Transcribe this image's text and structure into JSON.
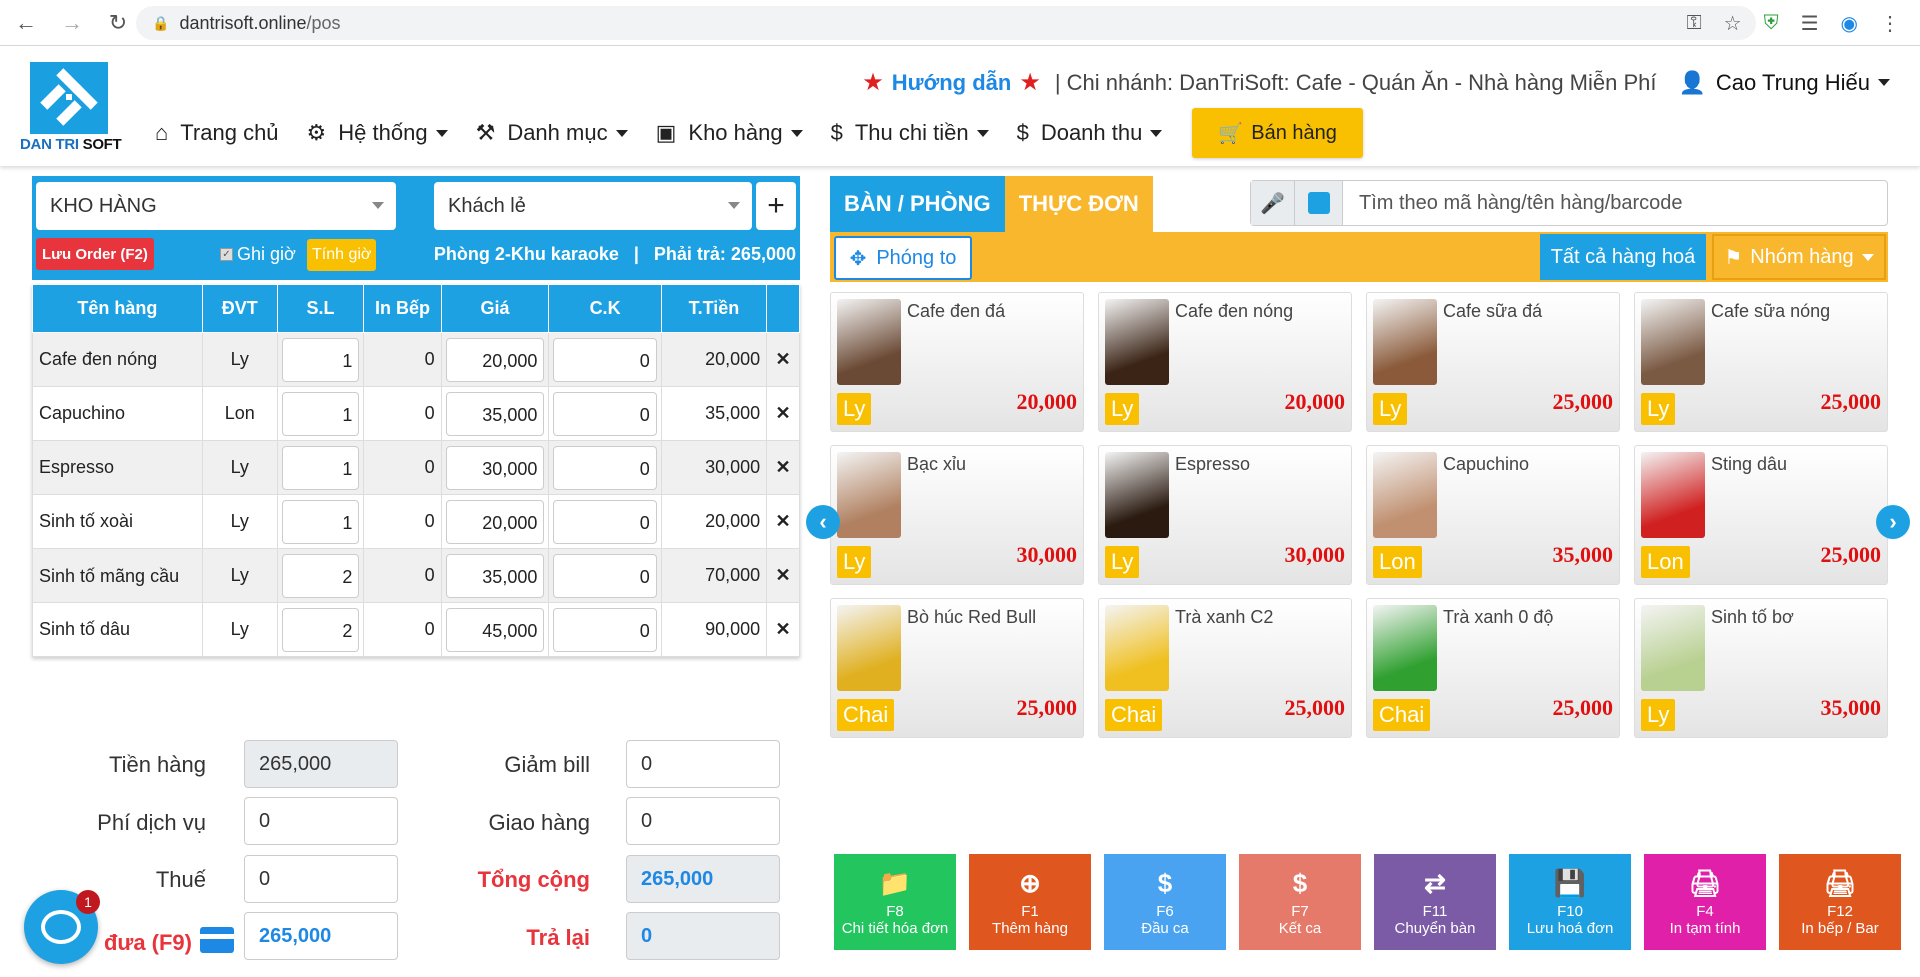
{
  "browser": {
    "url_host": "dantrisoft.online",
    "url_path": "/pos"
  },
  "header": {
    "logo_text_a": "DAN TRI",
    "logo_text_b": "SOFT",
    "guide": "Hướng dẫn",
    "branch": "| Chi nhánh: DanTriSoft: Cafe - Quán Ăn - Nhà hàng Miễn Phí",
    "user": "Cao Trung Hiếu",
    "nav": [
      "Trang chủ",
      "Hệ thống",
      "Danh mục",
      "Kho hàng",
      "Thu chi tiền",
      "Doanh thu"
    ],
    "sell": "Bán hàng"
  },
  "order": {
    "warehouse": "KHO HÀNG",
    "customer": "Khách lẻ",
    "save_order": "Lưu Order (F2)",
    "ghi_gio": "Ghi giờ",
    "tinh_gio": "Tính giờ",
    "room_info": "Phòng 2-Khu karaoke   |   Phải trả: 265,000",
    "columns": [
      "Tên hàng",
      "ĐVT",
      "S.L",
      "In Bếp",
      "Giá",
      "C.K",
      "T.Tiền"
    ],
    "rows": [
      {
        "name": "Cafe đen nóng",
        "unit": "Ly",
        "qty": "1",
        "kitchen": "0",
        "price": "20,000",
        "discount": "0",
        "total": "20,000"
      },
      {
        "name": "Capuchino",
        "unit": "Lon",
        "qty": "1",
        "kitchen": "0",
        "price": "35,000",
        "discount": "0",
        "total": "35,000"
      },
      {
        "name": "Espresso",
        "unit": "Ly",
        "qty": "1",
        "kitchen": "0",
        "price": "30,000",
        "discount": "0",
        "total": "30,000"
      },
      {
        "name": "Sinh tố xoài",
        "unit": "Ly",
        "qty": "1",
        "kitchen": "0",
        "price": "20,000",
        "discount": "0",
        "total": "20,000"
      },
      {
        "name": "Sinh tố mãng cầu",
        "unit": "Ly",
        "qty": "2",
        "kitchen": "0",
        "price": "35,000",
        "discount": "0",
        "total": "70,000"
      },
      {
        "name": "Sinh tố dâu",
        "unit": "Ly",
        "qty": "2",
        "kitchen": "0",
        "price": "45,000",
        "discount": "0",
        "total": "90,000"
      }
    ]
  },
  "totals": {
    "tien_hang_label": "Tiền hàng",
    "tien_hang": "265,000",
    "phi_dv_label": "Phí dịch vụ",
    "phi_dv": "0",
    "thue_label": "Thuế",
    "thue": "0",
    "dua_label": "đưa (F9)",
    "dua": "265,000",
    "giam_bill_label": "Giảm bill",
    "giam_bill": "0",
    "giao_hang_label": "Giao hàng",
    "giao_hang": "0",
    "tong_cong_label": "Tổng cộng",
    "tong_cong": "265,000",
    "tra_lai_label": "Trả lại",
    "tra_lai": "0",
    "chat_badge": "1"
  },
  "menu": {
    "tab_tables": "BÀN / PHÒNG",
    "tab_menu": "THỰC ĐƠN",
    "search_placeholder": "Tìm theo mã hàng/tên hàng/barcode",
    "zoom": "Phóng to",
    "all_items": "Tất cả hàng hoá",
    "groups": "Nhóm hàng",
    "products": [
      {
        "name": "Cafe đen đá",
        "unit": "Ly",
        "price": "20,000",
        "color": "#6b4a35"
      },
      {
        "name": "Cafe đen nóng",
        "unit": "Ly",
        "price": "20,000",
        "color": "#3b2416"
      },
      {
        "name": "Cafe sữa đá",
        "unit": "Ly",
        "price": "25,000",
        "color": "#8a5a3a"
      },
      {
        "name": "Cafe sữa nóng",
        "unit": "Ly",
        "price": "25,000",
        "color": "#7b5a44"
      },
      {
        "name": "Bạc xỉu",
        "unit": "Ly",
        "price": "30,000",
        "color": "#b08060"
      },
      {
        "name": "Espresso",
        "unit": "Ly",
        "price": "30,000",
        "color": "#2a1a10"
      },
      {
        "name": "Capuchino",
        "unit": "Lon",
        "price": "35,000",
        "color": "#c09070"
      },
      {
        "name": "Sting dâu",
        "unit": "Lon",
        "price": "25,000",
        "color": "#d02020"
      },
      {
        "name": "Bò húc Red Bull",
        "unit": "Chai",
        "price": "25,000",
        "color": "#e0b020"
      },
      {
        "name": "Trà xanh C2",
        "unit": "Chai",
        "price": "25,000",
        "color": "#f0c020"
      },
      {
        "name": "Trà xanh 0 độ",
        "unit": "Chai",
        "price": "25,000",
        "color": "#30a030"
      },
      {
        "name": "Sinh tố bơ",
        "unit": "Ly",
        "price": "35,000",
        "color": "#b8d090"
      }
    ]
  },
  "fkeys": [
    {
      "key": "F8",
      "label": "Chi tiết hóa đơn",
      "color": "#22c55e",
      "icon": "folder-icon"
    },
    {
      "key": "F1",
      "label": "Thêm hàng",
      "color": "#e0561f",
      "icon": "plus-circle-icon"
    },
    {
      "key": "F6",
      "label": "Đầu ca",
      "color": "#4aa3f0",
      "icon": "dollar-icon"
    },
    {
      "key": "F7",
      "label": "Kết ca",
      "color": "#e57a6a",
      "icon": "dollar-icon"
    },
    {
      "key": "F11",
      "label": "Chuyển bàn",
      "color": "#7b5aa6",
      "icon": "swap-icon"
    },
    {
      "key": "F10",
      "label": "Lưu hoá đơn",
      "color": "#1da1e2",
      "icon": "save-icon"
    },
    {
      "key": "F4",
      "label": "In tạm tính",
      "color": "#e020a8",
      "icon": "print-icon"
    },
    {
      "key": "F12",
      "label": "In bếp / Bar",
      "color": "#e0561f",
      "icon": "print-icon"
    }
  ]
}
